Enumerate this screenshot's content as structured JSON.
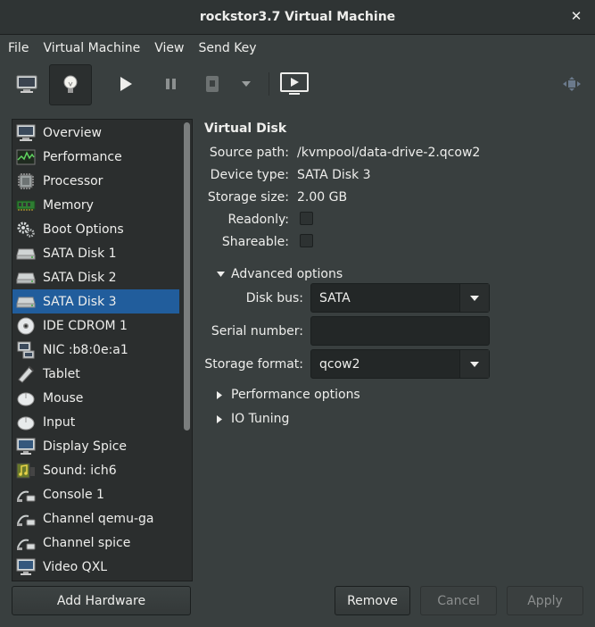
{
  "window": {
    "title": "rockstor3.7 Virtual Machine"
  },
  "menu": [
    "File",
    "Virtual Machine",
    "View",
    "Send Key"
  ],
  "sidebar": {
    "items": [
      {
        "label": "Overview",
        "icon": "monitor-icon"
      },
      {
        "label": "Performance",
        "icon": "performance-graph-icon"
      },
      {
        "label": "Processor",
        "icon": "processor-chip-icon"
      },
      {
        "label": "Memory",
        "icon": "memory-module-icon"
      },
      {
        "label": "Boot Options",
        "icon": "gears-icon"
      },
      {
        "label": "SATA Disk 1",
        "icon": "hard-disk-icon"
      },
      {
        "label": "SATA Disk 2",
        "icon": "hard-disk-icon"
      },
      {
        "label": "SATA Disk 3",
        "icon": "hard-disk-icon",
        "selected": true
      },
      {
        "label": "IDE CDROM 1",
        "icon": "cdrom-icon"
      },
      {
        "label": "NIC :b8:0e:a1",
        "icon": "network-card-icon"
      },
      {
        "label": "Tablet",
        "icon": "tablet-icon"
      },
      {
        "label": "Mouse",
        "icon": "mouse-icon"
      },
      {
        "label": "Input",
        "icon": "input-mouse-icon"
      },
      {
        "label": "Display Spice",
        "icon": "display-icon"
      },
      {
        "label": "Sound: ich6",
        "icon": "sound-icon"
      },
      {
        "label": "Console 1",
        "icon": "serial-cable-icon"
      },
      {
        "label": "Channel qemu-ga",
        "icon": "serial-cable-icon"
      },
      {
        "label": "Channel spice",
        "icon": "serial-cable-icon"
      },
      {
        "label": "Video QXL",
        "icon": "video-card-icon"
      }
    ]
  },
  "buttons": {
    "add_hardware": "Add Hardware",
    "remove": "Remove",
    "cancel": "Cancel",
    "apply": "Apply"
  },
  "disk": {
    "heading": "Virtual Disk",
    "source_label": "Source path:",
    "source_value": "/kvmpool/data-drive-2.qcow2",
    "device_label": "Device type:",
    "device_value": "SATA Disk 3",
    "size_label": "Storage size:",
    "size_value": "2.00 GB",
    "readonly_label": "Readonly:",
    "shareable_label": "Shareable:"
  },
  "advanced": {
    "label": "Advanced options",
    "bus_label": "Disk bus:",
    "bus_value": "SATA",
    "serial_label": "Serial number:",
    "serial_value": "",
    "format_label": "Storage format:",
    "format_value": "qcow2"
  },
  "performance_label": "Performance options",
  "io_label": "IO Tuning",
  "colors": {
    "selection": "#215d9c",
    "background": "#393f3f"
  }
}
